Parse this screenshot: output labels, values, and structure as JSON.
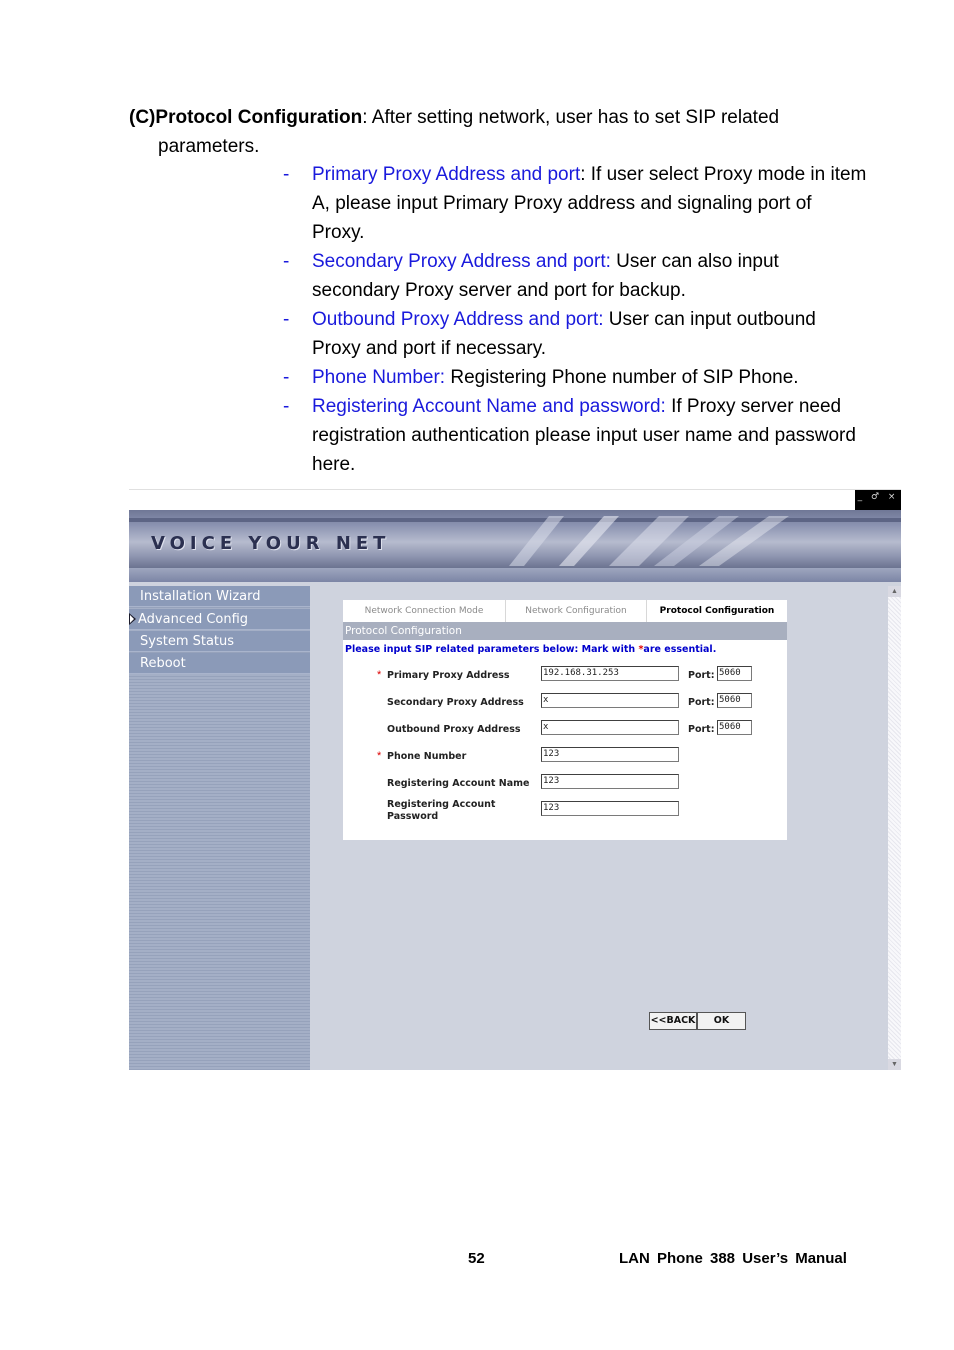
{
  "heading": {
    "marker": "(C)",
    "title": "Protocol Configuration",
    "intro": ": After setting network, user has to set SIP related",
    "continuation": "parameters."
  },
  "bullets": [
    {
      "dash": "-",
      "term": "Primary Proxy Address and port",
      "text": ": If user select Proxy mode in item A, please input Primary Proxy address and signaling port of Proxy."
    },
    {
      "dash": "-",
      "term": "Secondary Proxy Address and port:",
      "text": " User can also input secondary Proxy server and port for backup."
    },
    {
      "dash": "-",
      "term": "Outbound Proxy Address and port:",
      "text": " User can input outbound Proxy and port if necessary."
    },
    {
      "dash": "-",
      "term": "Phone Number:",
      "text": " Registering Phone number of SIP Phone."
    },
    {
      "dash": "-",
      "term": "Registering Account Name and password:",
      "text": " If Proxy server need registration authentication please input user name and password here."
    }
  ],
  "screenshot": {
    "window_controls": "_ ♂ ×",
    "banner_logo": "VOICE YOUR NET",
    "nav": {
      "items": [
        {
          "label": "Installation Wizard"
        },
        {
          "label": "Advanced Config"
        },
        {
          "label": "System Status"
        },
        {
          "label": "Reboot"
        }
      ]
    },
    "tabs": [
      {
        "label": "Network Connection Mode"
      },
      {
        "label": "Network Configuration"
      },
      {
        "label": "Protocol Configuration"
      }
    ],
    "panel_title": "Protocol Configuration",
    "instruction": {
      "before": "Please input SIP related parameters below: Mark with ",
      "star": "*",
      "after": "are essential."
    },
    "fields": {
      "primary_proxy": {
        "required": "*",
        "label": "Primary Proxy Address",
        "value": "192.168.31.253",
        "port_label": "Port:",
        "port": "5060"
      },
      "secondary_proxy": {
        "label": "Secondary Proxy Address",
        "value": "x",
        "port_label": "Port:",
        "port": "5060"
      },
      "outbound_proxy": {
        "label": "Outbound Proxy Address",
        "value": "x",
        "port_label": "Port:",
        "port": "5060"
      },
      "phone_number": {
        "required": "*",
        "label": "Phone Number",
        "value": "123"
      },
      "account_name": {
        "label": "Registering Account Name",
        "value": "123"
      },
      "account_password": {
        "label_line1": "Registering Account",
        "label_line2": "Password",
        "value": "123"
      }
    },
    "buttons": {
      "back": "<<BACK",
      "ok": "OK"
    },
    "scroll": {
      "up": "▲",
      "down": "▼"
    }
  },
  "footer": {
    "page_number": "52",
    "manual_title": "LAN Phone 388 User’s Manual"
  }
}
